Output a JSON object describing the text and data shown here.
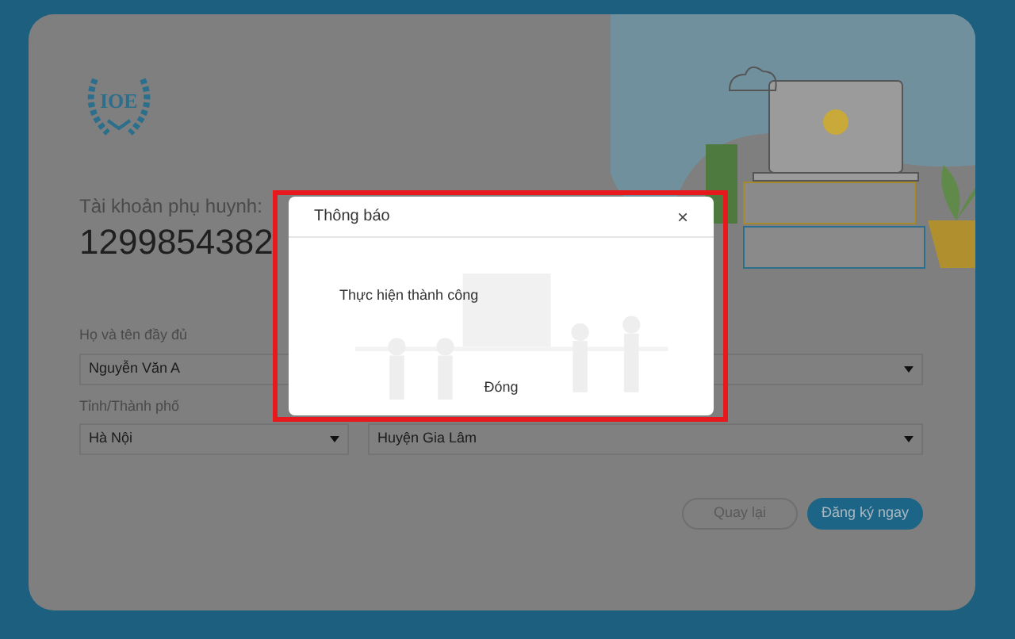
{
  "logo": {
    "text": "IOE"
  },
  "account": {
    "label": "Tài khoản phụ huynh:",
    "number": "1299854382"
  },
  "form": {
    "rows": [
      {
        "label": "Họ và tên đầy đủ",
        "fields": [
          {
            "kind": "text",
            "value": "Nguyễn Văn A"
          },
          {
            "kind": "select"
          }
        ]
      },
      {
        "label": "Tỉnh/Thành phố",
        "fields": [
          {
            "kind": "select",
            "value": "Hà Nội"
          },
          {
            "kind": "select",
            "value": "Huyện Gia Lâm"
          }
        ]
      }
    ]
  },
  "buttons": [
    {
      "label": "Quay lại",
      "kind": "secondary"
    },
    {
      "label": "Đăng ký ngay",
      "kind": "primary"
    }
  ],
  "dialog": {
    "title": "Thông báo",
    "close": "×",
    "message": "Thực hiện thành công",
    "button": "Đóng"
  }
}
